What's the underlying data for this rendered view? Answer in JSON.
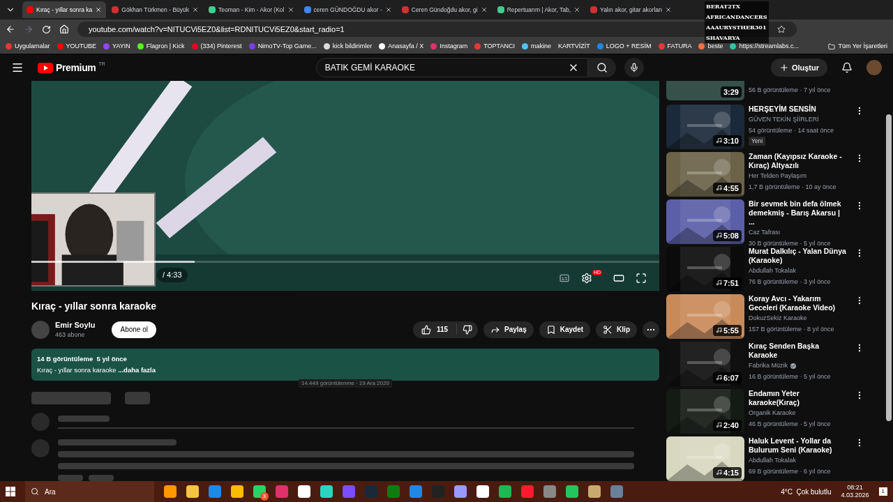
{
  "browser": {
    "tabs": [
      {
        "title": "Kıraç - yıllar sonra ka",
        "selected": true,
        "color": "#ff0000"
      },
      {
        "title": "Gökhan Türkmen - Büyük",
        "selected": false,
        "color": "#d32f2f"
      },
      {
        "title": "Teoman - Kim - Akor (Kol",
        "selected": false,
        "color": "#3ccf8e"
      },
      {
        "title": "ceren GÜNDOĞDU akor -",
        "selected": false,
        "color": "#4285f4"
      },
      {
        "title": "Ceren Gündoğdu akor, gi",
        "selected": false,
        "color": "#d32f2f"
      },
      {
        "title": "Repertuarım | Akor, Tab,",
        "selected": false,
        "color": "#3ccf8e"
      },
      {
        "title": "Yalın akor, gitar akorları",
        "selected": false,
        "color": "#d32f2f"
      }
    ],
    "url": "youtube.com/watch?v=NITUCVi5EZ0&list=RDNITUCVi5EZ0&start_radio=1",
    "bookmarks": [
      {
        "label": "Uygulamalar",
        "color": "#e53935"
      },
      {
        "label": "YOUTUBE",
        "color": "#ff0000"
      },
      {
        "label": "YAYIN",
        "color": "#9146ff"
      },
      {
        "label": "Flagron | Kick",
        "color": "#53fc18"
      },
      {
        "label": "(334) Pinterest",
        "color": "#e60023"
      },
      {
        "label": "NimoTV-Top Game...",
        "color": "#7b3fe4"
      },
      {
        "label": "kick bildirimler",
        "color": "#dddddd"
      },
      {
        "label": "Anasayfa / X",
        "color": "#ffffff"
      },
      {
        "label": "Instagram",
        "color": "#e1306c"
      },
      {
        "label": "TOPTANCI",
        "color": "#e53935"
      },
      {
        "label": "makine",
        "color": "#4fc3f7"
      },
      {
        "label": "KARTVİZİT"
      },
      {
        "label": "LOGO + RESİM",
        "color": "#1e88e5"
      },
      {
        "label": "FATURA",
        "color": "#e53935"
      },
      {
        "label": "beste",
        "color": "#ff7043"
      },
      {
        "label": "https://streamlabs.c...",
        "color": "#31c3a2"
      }
    ],
    "all_bookmarks": "Tüm Yer İşaretleri"
  },
  "stream_overlay": [
    "BERAT2TX",
    "AFRICANDANCERS",
    "AAAURYSTHER301",
    "SHAVARYA"
  ],
  "header": {
    "logo": "Premium",
    "region": "TR",
    "search": {
      "value": "BATIK GEMİ KARAOKE"
    },
    "create": "Oluştur"
  },
  "player": {
    "time": "/ 4:33",
    "level": 0.26,
    "quality_badge": "HD"
  },
  "video": {
    "title": "Kıraç - yıllar sonra karaoke",
    "channel": "Emir Soylu",
    "subscribers": "463 abone",
    "subscribe": "Abone ol",
    "likes": "115",
    "actions": [
      "Paylaş",
      "Kaydet",
      "Klip"
    ],
    "description": {
      "stats": "14 B görüntüleme  5 yıl önce",
      "text": "Kıraç - yıllar sonra karaoke",
      "more": "...daha fazla"
    },
    "faded_note": "14.449 görüntülenme · 19 Ara 2020"
  },
  "related": [
    {
      "meta": "56 B görüntüleme · 7 yıl önce",
      "duration": "3:29"
    },
    {
      "title": "HERŞEYİM SENSİN",
      "channel": "GÜVEN TEKİN ŞİİRLERİ",
      "meta": "54 görüntüleme · 14 saat önce",
      "badge": "Yeni",
      "duration": "3:10"
    },
    {
      "title": "Zaman (Kayıpsız Karaoke - Kıraç) Altyazılı",
      "channel": "Her Telden Paylaşım",
      "meta": "1,7 B görüntüleme · 10 ay önce",
      "duration": "4:55"
    },
    {
      "title": "Bir sevmek bin defa ölmek demekmiş - Barış Akarsu | ...",
      "channel": "Caz Tafrası",
      "meta": "30 B görüntüleme · 5 yıl önce",
      "duration": "5:08"
    },
    {
      "title": "Murat Dalkılıç - Yalan Dünya (Karaoke)",
      "channel": "Abdullah Tokalak",
      "meta": "76 B görüntüleme · 3 yıl önce",
      "duration": "7:51"
    },
    {
      "title": "Koray Avcı - Yakarım Geceleri (Karaoke Video)",
      "channel": "DokuzSekiz Karaoke",
      "meta": "157 B görüntüleme · 8 yıl önce",
      "duration": "5:55"
    },
    {
      "title": "Kıraç Senden Başka Karaoke",
      "channel": "Fabrika Müzik",
      "verified": true,
      "meta": "16 B görüntüleme · 5 yıl önce",
      "duration": "6:07"
    },
    {
      "title": "Endamın Yeter karaoke(Kıraç)",
      "channel": "Organik Karaoke",
      "meta": "46 B görüntüleme · 5 yıl önce",
      "duration": "2:40"
    },
    {
      "title": "Haluk Levent - Yollar da Bulurum Seni (Karaoke)",
      "channel": "Abdullah Tokalak",
      "meta": "69 B görüntüleme · 6 yıl önce",
      "duration": "4:15"
    }
  ],
  "taskbar": {
    "search": "Ara",
    "whatsapp_badge": "3",
    "weather": "4°C  Çok bulutlu",
    "time": "08:21",
    "date": "4.03.2026",
    "notifications": "1"
  }
}
